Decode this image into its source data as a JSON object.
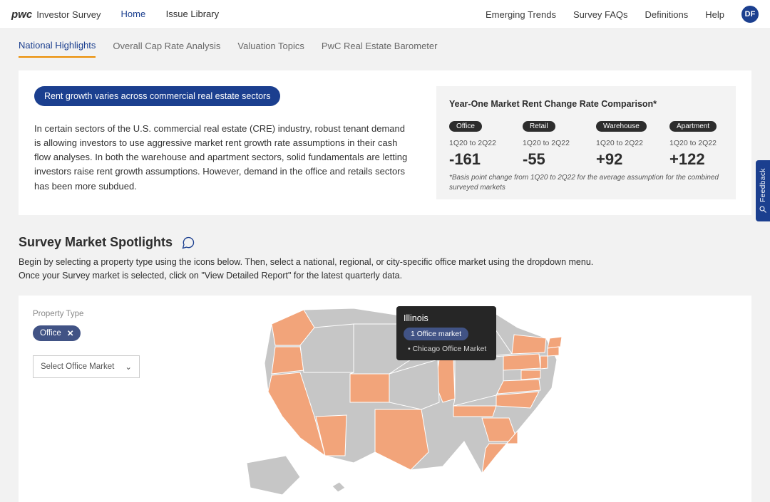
{
  "brand": {
    "bold": "pwc",
    "light": "Investor Survey"
  },
  "primary_nav": {
    "home": "Home",
    "library": "Issue Library"
  },
  "right_nav": {
    "trends": "Emerging Trends",
    "faqs": "Survey FAQs",
    "defs": "Definitions",
    "help": "Help"
  },
  "avatar": "DF",
  "tabs": {
    "t0": "National Highlights",
    "t1": "Overall Cap Rate Analysis",
    "t2": "Valuation Topics",
    "t3": "PwC Real Estate Barometer"
  },
  "highlight_pill": "Rent growth varies across commercial real estate sectors",
  "highlight_para": "In certain sectors of the U.S. commercial real estate (CRE) industry, robust tenant demand is allowing investors to use aggressive market rent growth rate assumptions in their cash flow analyses. In both the warehouse and apartment sectors, solid fundamentals are letting investors raise rent growth assumptions. However, demand in the office and retails sectors has been more subdued.",
  "compare_title": "Year-One Market Rent Change Rate Comparison*",
  "period": "1Q20 to 2Q22",
  "metrics": [
    {
      "tag": "Office",
      "value": "-161"
    },
    {
      "tag": "Retail",
      "value": "-55"
    },
    {
      "tag": "Warehouse",
      "value": "+92"
    },
    {
      "tag": "Apartment",
      "value": "+122"
    }
  ],
  "compare_footnote": "*Basis point change from 1Q20 to 2Q22 for the average assumption for the combined surveyed markets",
  "spot_title": "Survey Market Spotlights",
  "spot_sub1": "Begin by selecting a property type using the icons below. Then, select a national, regional, or city-specific office market using the dropdown menu.",
  "spot_sub2": "Once your Survey market is selected, click on \"View Detailed Report\" for the latest quarterly data.",
  "property_label": "Property Type",
  "property_pill": "Office",
  "dropdown_placeholder": "Select Office Market",
  "tooltip": {
    "title": "Illinois",
    "pill": "1 Office market",
    "row1": "Chicago Office Market"
  },
  "feedback": "Feedback",
  "chart_data": {
    "type": "table",
    "title": "Year-One Market Rent Change Rate Comparison*",
    "note": "Basis point change from 1Q20 to 2Q22 for the average assumption for the combined surveyed markets",
    "period": "1Q20 to 2Q22",
    "series": [
      {
        "name": "Office",
        "value_bp": -161
      },
      {
        "name": "Retail",
        "value_bp": -55
      },
      {
        "name": "Warehouse",
        "value_bp": 92
      },
      {
        "name": "Apartment",
        "value_bp": 122
      }
    ]
  }
}
